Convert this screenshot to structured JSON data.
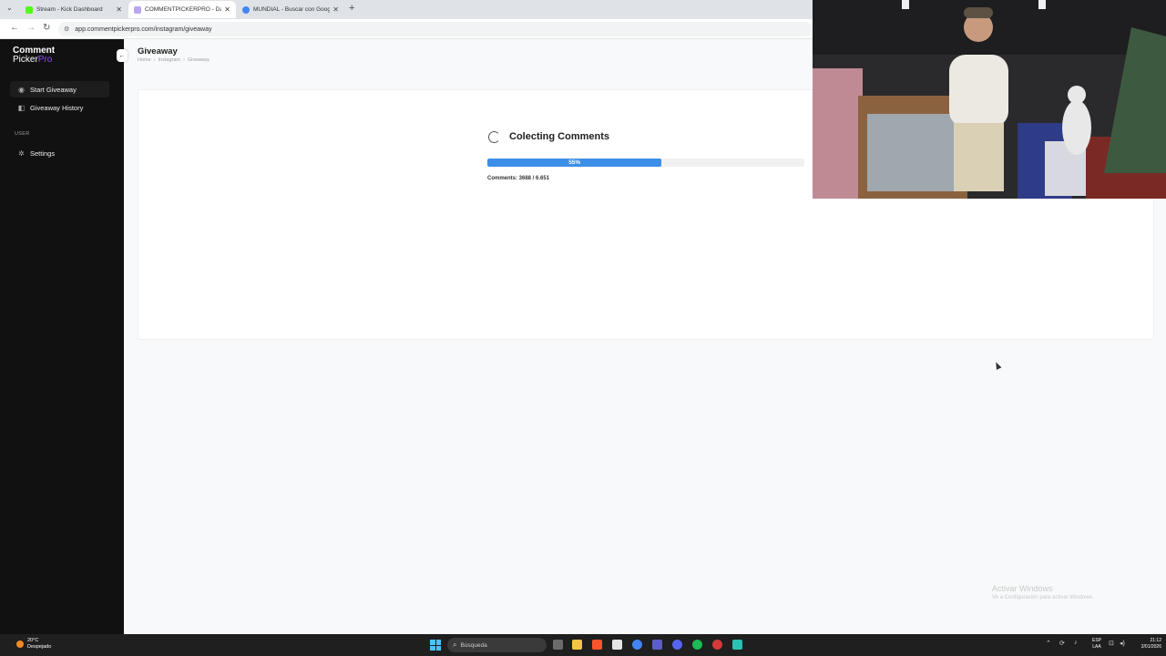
{
  "browser": {
    "tabs": [
      {
        "title": "Stream - Kick Dashboard",
        "favicon_color": "#53fc18",
        "active": false
      },
      {
        "title": "COMMENTPICKERPRO - Dashb",
        "favicon_color": "#b9a6f0",
        "active": true
      },
      {
        "title": "MUNDIAL - Buscar con Google",
        "favicon_color": "#4285f4",
        "active": false
      }
    ],
    "url": "app.commentpickerpro.com/instagram/giveaway",
    "tab_close_glyph": "✕",
    "new_tab_glyph": "+",
    "menu_glyph": "⌄",
    "back_glyph": "←",
    "forward_glyph": "→",
    "reload_glyph": "↻",
    "site_info_glyph": "⚙"
  },
  "sidebar": {
    "logo_line1": "Comment",
    "logo_line2": "Picker",
    "logo_pro": "Pro",
    "collapse_glyph": "←",
    "items": [
      {
        "label": "Start Giveaway",
        "icon": "play-circle-icon",
        "glyph": "◉"
      },
      {
        "label": "Giveaway History",
        "icon": "history-icon",
        "glyph": "◧"
      }
    ],
    "section_label": "USER",
    "settings": {
      "label": "Settings",
      "icon": "gear-icon",
      "glyph": "✲"
    }
  },
  "main": {
    "title": "Giveaway",
    "breadcrumb": [
      "Home",
      "Instagram",
      "Giveaway"
    ],
    "breadcrumb_separator": "›",
    "status_title": "Colecting Comments",
    "progress_percent": 55,
    "progress_label": "55%",
    "comments_label": "Comments: 3688 / 6.651"
  },
  "windows_watermark": {
    "title": "Activar Windows",
    "subtitle": "Ve a Configuración para activar Windows."
  },
  "taskbar": {
    "weather_temp": "20°C",
    "weather_desc": "Despejado",
    "search_placeholder": "Búsqueda",
    "search_glyph": "⌕",
    "lang_line1": "ESP",
    "lang_line2": "LAA",
    "time": "21:12",
    "date": "2/01/2026",
    "tray_chevron": "⌃",
    "tray_icons": [
      "⟳",
      "♪",
      "⊡",
      "◂)"
    ]
  },
  "colors": {
    "accent": "#3b8fe6",
    "sidebar_bg": "#111111",
    "logo_pro": "#8e4cf3"
  }
}
